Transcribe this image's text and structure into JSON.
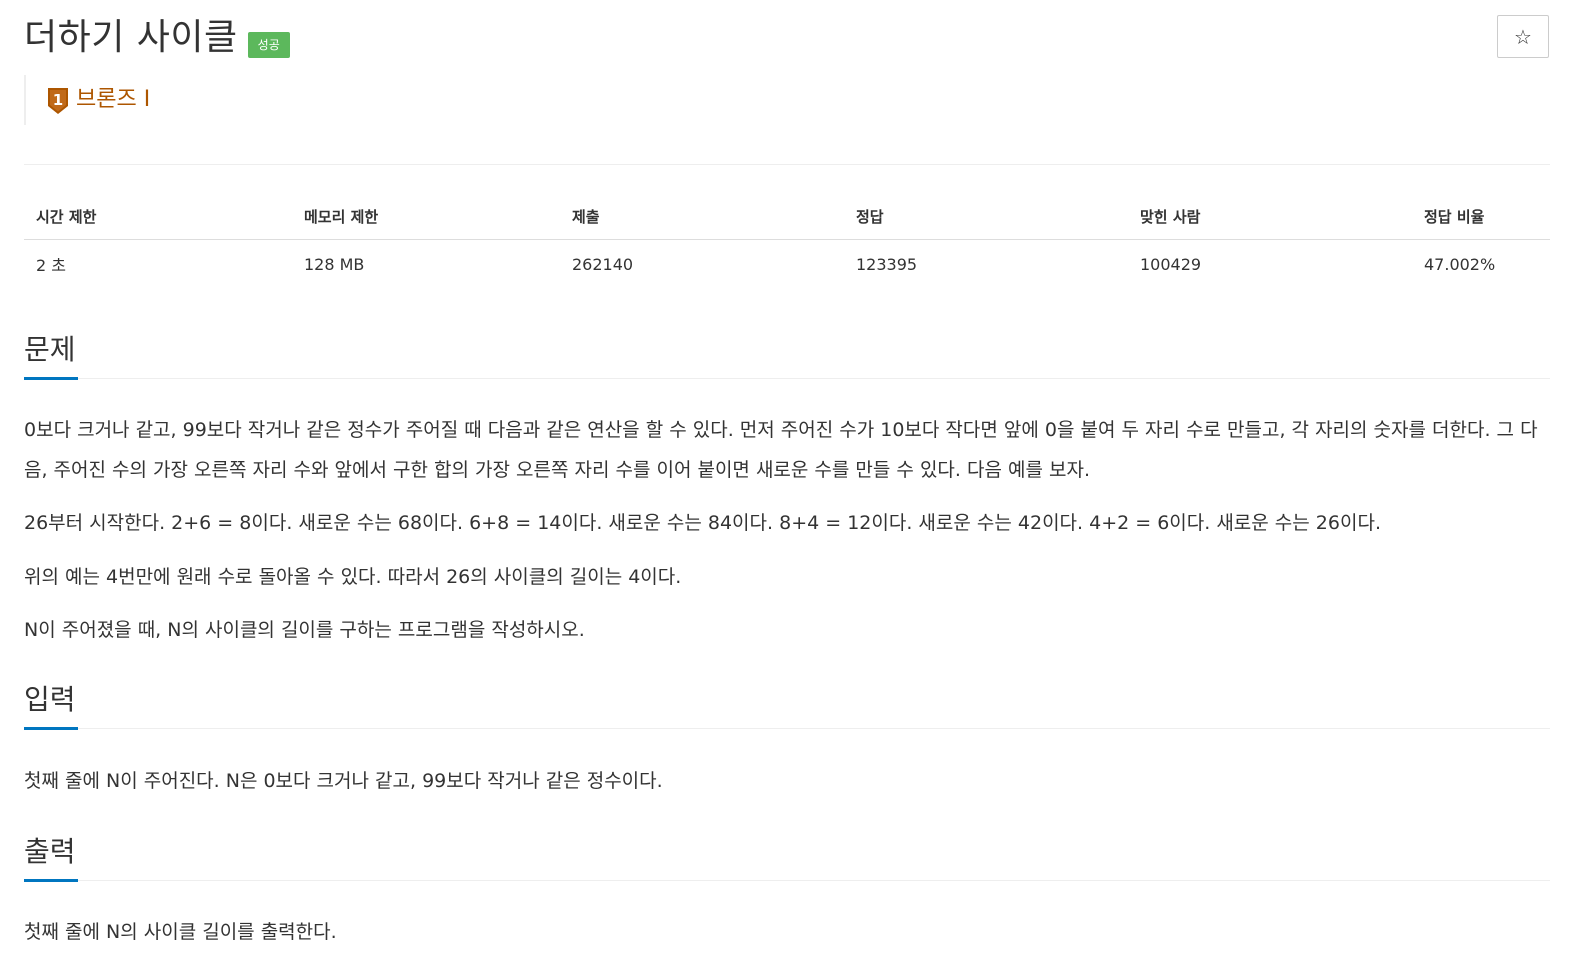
{
  "problem": {
    "title": "더하기 사이클",
    "status_badge": "성공",
    "tier": {
      "label": "브론즈 I",
      "level": "1",
      "color": "#ad5600"
    }
  },
  "star_button": {
    "icon": "star-outline-icon",
    "glyph": "☆"
  },
  "info_table": {
    "headers": [
      "시간 제한",
      "메모리 제한",
      "제출",
      "정답",
      "맞힌 사람",
      "정답 비율"
    ],
    "values": [
      "2 초",
      "128 MB",
      "262140",
      "123395",
      "100429",
      "47.002%"
    ]
  },
  "sections": {
    "description": {
      "title": "문제",
      "paragraphs": [
        "0보다 크거나 같고, 99보다 작거나 같은 정수가 주어질 때 다음과 같은 연산을 할 수 있다. 먼저 주어진 수가 10보다 작다면 앞에 0을 붙여 두 자리 수로 만들고, 각 자리의 숫자를 더한다. 그 다음, 주어진 수의 가장 오른쪽 자리 수와 앞에서 구한 합의 가장 오른쪽 자리 수를 이어 붙이면 새로운 수를 만들 수 있다. 다음 예를 보자.",
        "26부터 시작한다. 2+6 = 8이다. 새로운 수는 68이다. 6+8 = 14이다. 새로운 수는 84이다. 8+4 = 12이다. 새로운 수는 42이다. 4+2 = 6이다. 새로운 수는 26이다.",
        "위의 예는 4번만에 원래 수로 돌아올 수 있다. 따라서 26의 사이클의 길이는 4이다.",
        "N이 주어졌을 때, N의 사이클의 길이를 구하는 프로그램을 작성하시오."
      ]
    },
    "input": {
      "title": "입력",
      "paragraphs": [
        "첫째 줄에 N이 주어진다. N은 0보다 크거나 같고, 99보다 작거나 같은 정수이다."
      ]
    },
    "output": {
      "title": "출력",
      "paragraphs": [
        "첫째 줄에 N의 사이클 길이를 출력한다."
      ]
    }
  },
  "colors": {
    "accent": "#0076c0",
    "success": "#5cb85c",
    "bronze": "#ad5600"
  }
}
